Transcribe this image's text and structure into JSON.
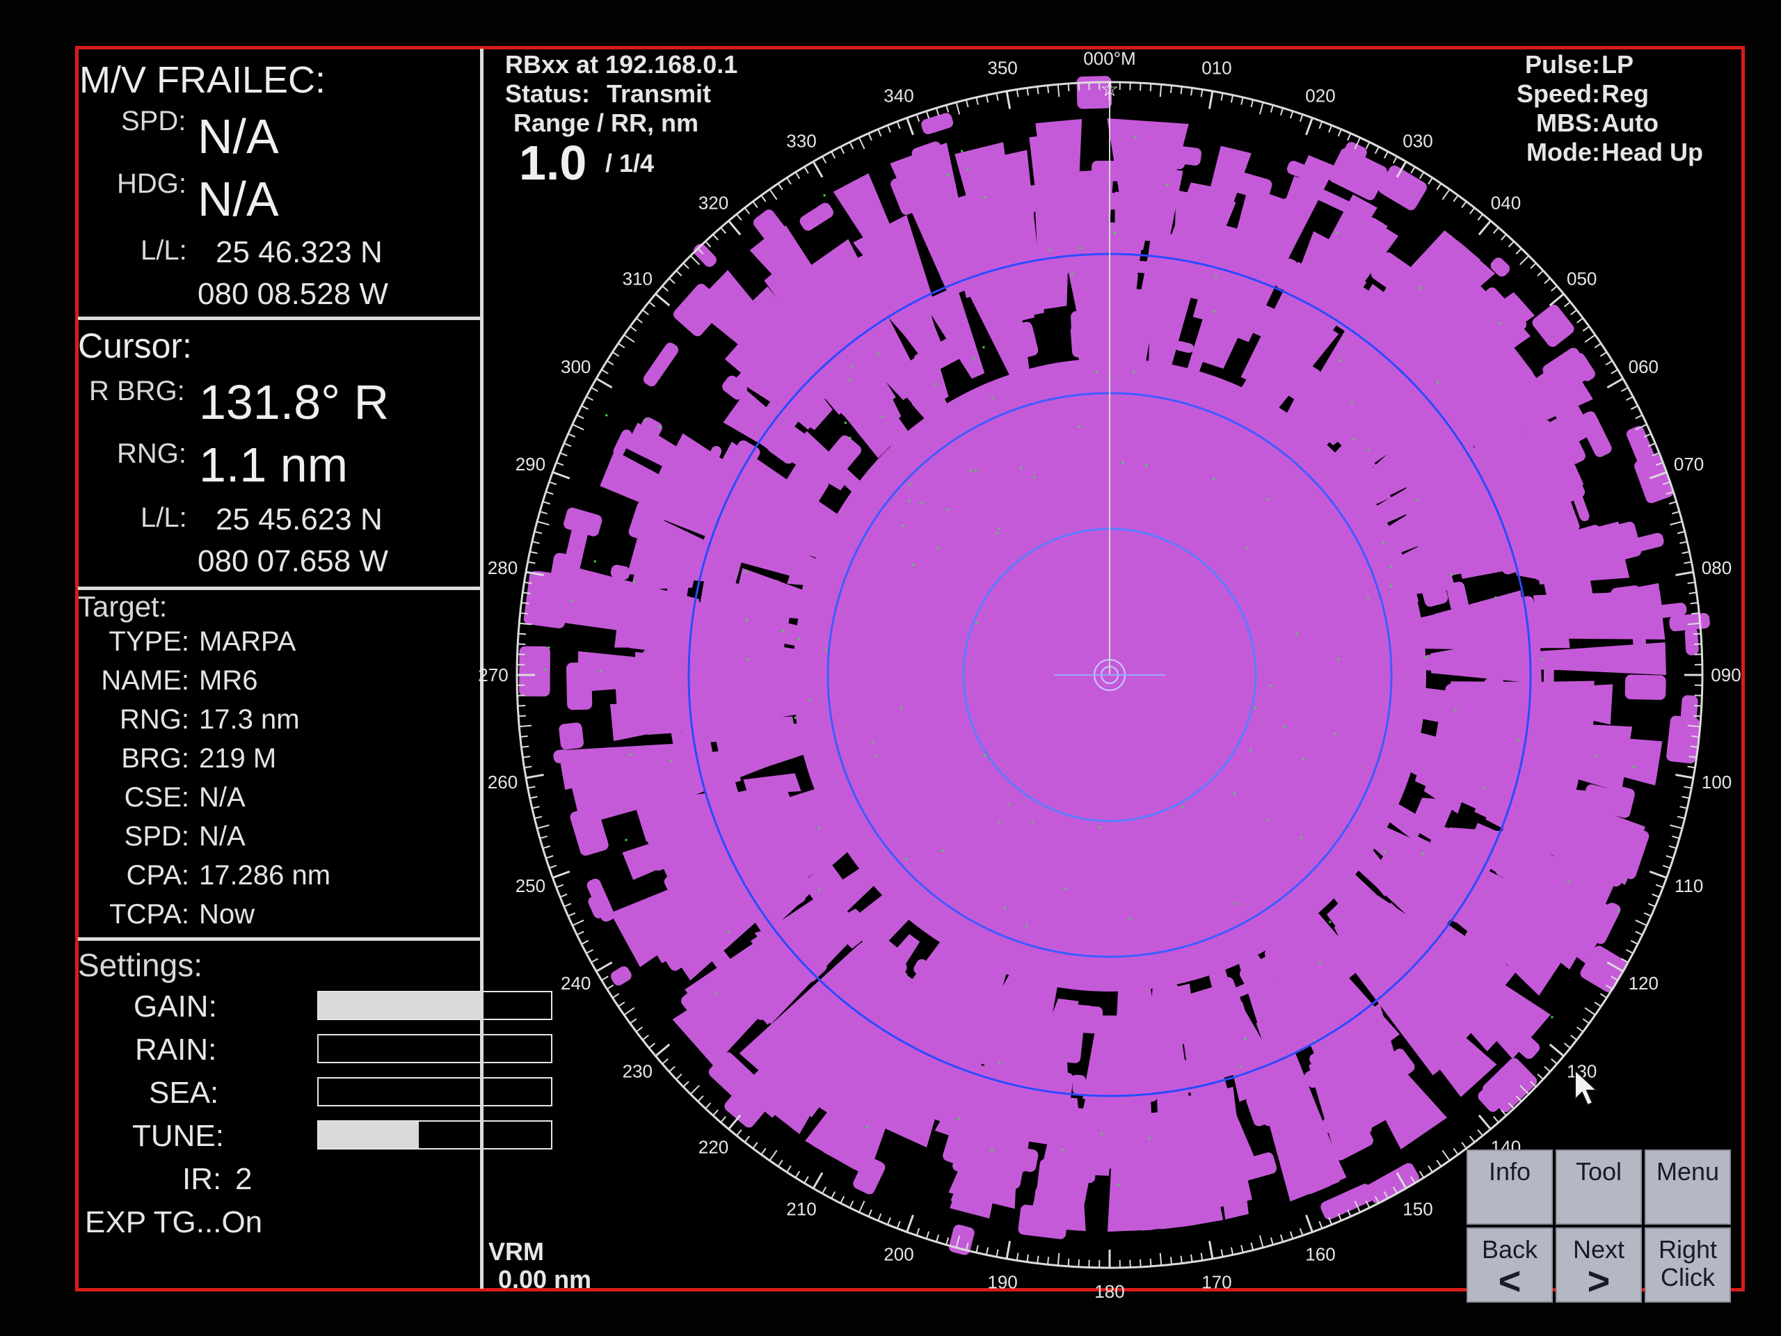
{
  "vessel": {
    "name": "M/V FRAILEC:",
    "spd_label": "SPD:",
    "spd": "N/A",
    "hdg_label": "HDG:",
    "hdg": "N/A",
    "ll_label": "L/L:",
    "lat": "25 46.323 N",
    "lon": "080 08.528 W"
  },
  "cursor": {
    "title": "Cursor:",
    "rbrg_label": "R BRG:",
    "rbrg": "131.8° R",
    "rng_label": "RNG:",
    "rng": "1.1 nm",
    "ll_label": "L/L:",
    "lat": "25 45.623 N",
    "lon": "080 07.658 W"
  },
  "target": {
    "title": "Target:",
    "rows": [
      {
        "label": "TYPE:",
        "value": "MARPA"
      },
      {
        "label": "NAME:",
        "value": "MR6"
      },
      {
        "label": "RNG:",
        "value": "17.3 nm"
      },
      {
        "label": "BRG:",
        "value": "219 M"
      },
      {
        "label": "CSE:",
        "value": "N/A"
      },
      {
        "label": "SPD:",
        "value": "N/A"
      },
      {
        "label": "CPA:",
        "value": "17.286 nm"
      },
      {
        "label": "TCPA:",
        "value": "Now"
      }
    ]
  },
  "settings": {
    "title": "Settings:",
    "gain_label": "GAIN:",
    "gain_level": 0.7,
    "rain_label": "RAIN:",
    "rain_level": 0.0,
    "sea_label": "SEA:",
    "sea_level": 0.0,
    "tune_label": "TUNE:",
    "tune_level": 0.43,
    "ir_label": "IR:",
    "ir": "2",
    "exp_tg": "EXP TG...On"
  },
  "radar_header": {
    "source": "RBxx at 192.168.0.1",
    "status_label": "Status:",
    "status": "Transmit",
    "range_label": "Range / RR, nm",
    "range": "1.0",
    "ring_range": "/ 1/4"
  },
  "radar_params": {
    "pulse_label": "Pulse:",
    "pulse": "LP",
    "speed_label": "Speed:",
    "speed": "Reg",
    "mbs_label": "MBS:",
    "mbs": "Auto",
    "mode_label": "Mode:",
    "mode": "Head Up"
  },
  "vrm": {
    "label": "VRM",
    "value": "0.00 nm"
  },
  "compass": {
    "labels": [
      "000°M",
      "010",
      "020",
      "030",
      "040",
      "050",
      "060",
      "070",
      "080",
      "090",
      "100",
      "110",
      "120",
      "130",
      "140",
      "150",
      "160",
      "170",
      "180",
      "190",
      "200",
      "210",
      "220",
      "230",
      "240",
      "250",
      "260",
      "270",
      "280",
      "290",
      "300",
      "310",
      "320",
      "330",
      "340",
      "350"
    ]
  },
  "buttons": {
    "info": "Info",
    "tool": "Tool",
    "menu": "Menu",
    "back": "Back",
    "back_arrow": "<",
    "next": "Next",
    "next_arrow": ">",
    "right_click": "Right Click"
  },
  "colors": {
    "echo": "#c55ad9",
    "ring": "#2a4bff",
    "frame": "#d81b1b"
  }
}
